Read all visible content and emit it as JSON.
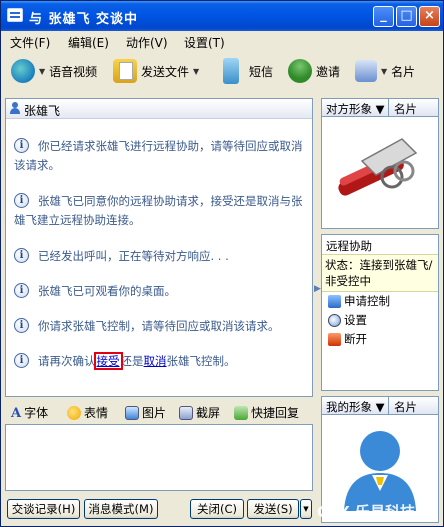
{
  "window": {
    "title": "与 张雄飞 交谈中",
    "controls": {
      "minimize": "_",
      "maximize": "□",
      "close": "×"
    }
  },
  "menu": [
    "文件(F)",
    "编辑(E)",
    "动作(V)",
    "设置(T)"
  ],
  "toolbar": {
    "video": "语音视频",
    "send_file": "发送文件",
    "sms": "短信",
    "invite": "邀请",
    "card": "名片"
  },
  "chat": {
    "contact_name": "张雄飞",
    "messages": [
      "你已经请求张雄飞进行远程协助，请等待回应或取消该请求。",
      "张雄飞已同意你的远程协助请求，接受还是取消与张雄飞建立远程协助连接。",
      "已经发出呼叫，正在等待对方响应. . .",
      "张雄飞已可观看你的桌面。",
      "你请求张雄飞控制，请等待回应或取消该请求。"
    ],
    "confirm": {
      "prefix": "请再次确认",
      "accept": "接受",
      "middle": "还是",
      "cancel": "取消",
      "suffix": "张雄飞控制。"
    }
  },
  "format_bar": {
    "font": "字体",
    "emotion": "表情",
    "picture": "图片",
    "screenshot": "截屏",
    "quick_reply": "快捷回复"
  },
  "input": {
    "value": ""
  },
  "buttons": {
    "history": "交谈记录(H)",
    "message_mode": "消息模式(M)",
    "close": "关闭(C)",
    "send": "发送(S)"
  },
  "right": {
    "their_tab": "对方形象",
    "card_tab": "名片",
    "remote_title": "远程协助",
    "status": "状态：连接到张雄飞/非受控中",
    "actions": {
      "request_control": "申请控制",
      "settings": "设置",
      "disconnect": "断开"
    },
    "my_tab": "我的形象"
  },
  "watermark": "CEX 乐易科技"
}
